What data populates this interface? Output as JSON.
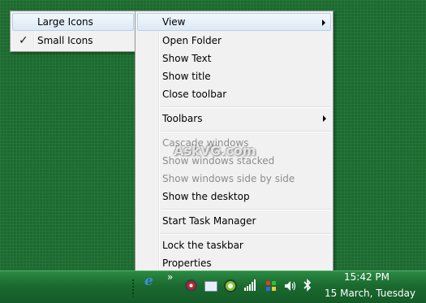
{
  "submenu": {
    "items": [
      {
        "label": "Large Icons",
        "checked": false,
        "highlighted": true
      },
      {
        "label": "Small Icons",
        "checked": true,
        "highlighted": false
      }
    ],
    "check_glyph": "✓"
  },
  "context_menu": {
    "view": "View",
    "open_folder": "Open Folder",
    "show_text": "Show Text",
    "show_title": "Show title",
    "close_toolbar": "Close toolbar",
    "toolbars": "Toolbars",
    "cascade_windows": "Cascade windows",
    "show_windows_stacked": "Show windows stacked",
    "show_windows_side_by_side": "Show windows side by side",
    "show_desktop": "Show the desktop",
    "start_task_manager": "Start Task Manager",
    "lock_taskbar": "Lock the taskbar",
    "properties": "Properties"
  },
  "watermark": "AskVG.com",
  "taskbar": {
    "chevron": "»",
    "clock_time": "15:42 PM",
    "clock_date": "15 March, Tuesday",
    "tray_icons": [
      "ie-icon",
      "antivirus-icon",
      "network-icon",
      "app-icon",
      "signal-icon",
      "volume-icon",
      "bluetooth-icon"
    ]
  },
  "colors": {
    "desktop": "#1b6a2e",
    "menu_bg": "#f1f1f1",
    "highlight": "#dde9f6",
    "disabled_text": "#8d8d8d"
  }
}
